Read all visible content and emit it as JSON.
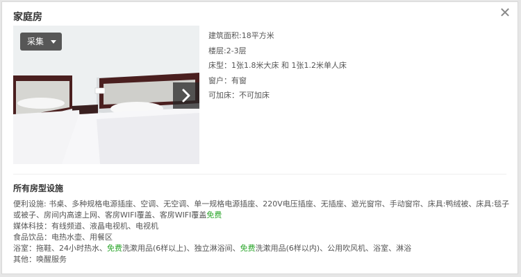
{
  "dialog": {
    "title": "家庭房",
    "close_glyph": "✕"
  },
  "photo": {
    "collect_label": "采集"
  },
  "room_info": [
    {
      "label": "建筑面积:",
      "value": "18平方米"
    },
    {
      "label": "楼层:",
      "value": "2-3层"
    },
    {
      "label": "床型：",
      "value": "1张1.8米大床 和 1张1.2米单人床"
    },
    {
      "label": "窗户：",
      "value": "有窗"
    },
    {
      "label": "可加床：",
      "value": "不可加床"
    }
  ],
  "facilities": {
    "title": "所有房型设施",
    "convenience": {
      "label": "便利设施: ",
      "text1": "书桌、多种规格电源插座、空调、无空调、单一规格电源插座、220V电压插座、无插座、遮光窗帘、手动窗帘、床具:鸭绒被、床具:毯子或被子、房间内高速上网、客房WIFI覆盖、客房WIFI覆盖",
      "free": "免费"
    },
    "media": {
      "label": "媒体科技：",
      "text": "有线频道、液晶电视机、电视机"
    },
    "food": {
      "label": "食品饮品：",
      "text": "电热水壶、用餐区"
    },
    "bath": {
      "label": "浴室：",
      "text1": "拖鞋、24小时热水、",
      "free1": "免费",
      "text2": "洗漱用品(6样以上)、独立淋浴间、",
      "free2": "免费",
      "text3": "洗漱用品(6样以内)、公用吹风机、浴室、淋浴"
    },
    "other": {
      "label": "其他：",
      "text": "唤醒服务"
    }
  },
  "colors": {
    "free_highlight": "#2aa52a",
    "overlay_button": "#3c3c3c"
  }
}
